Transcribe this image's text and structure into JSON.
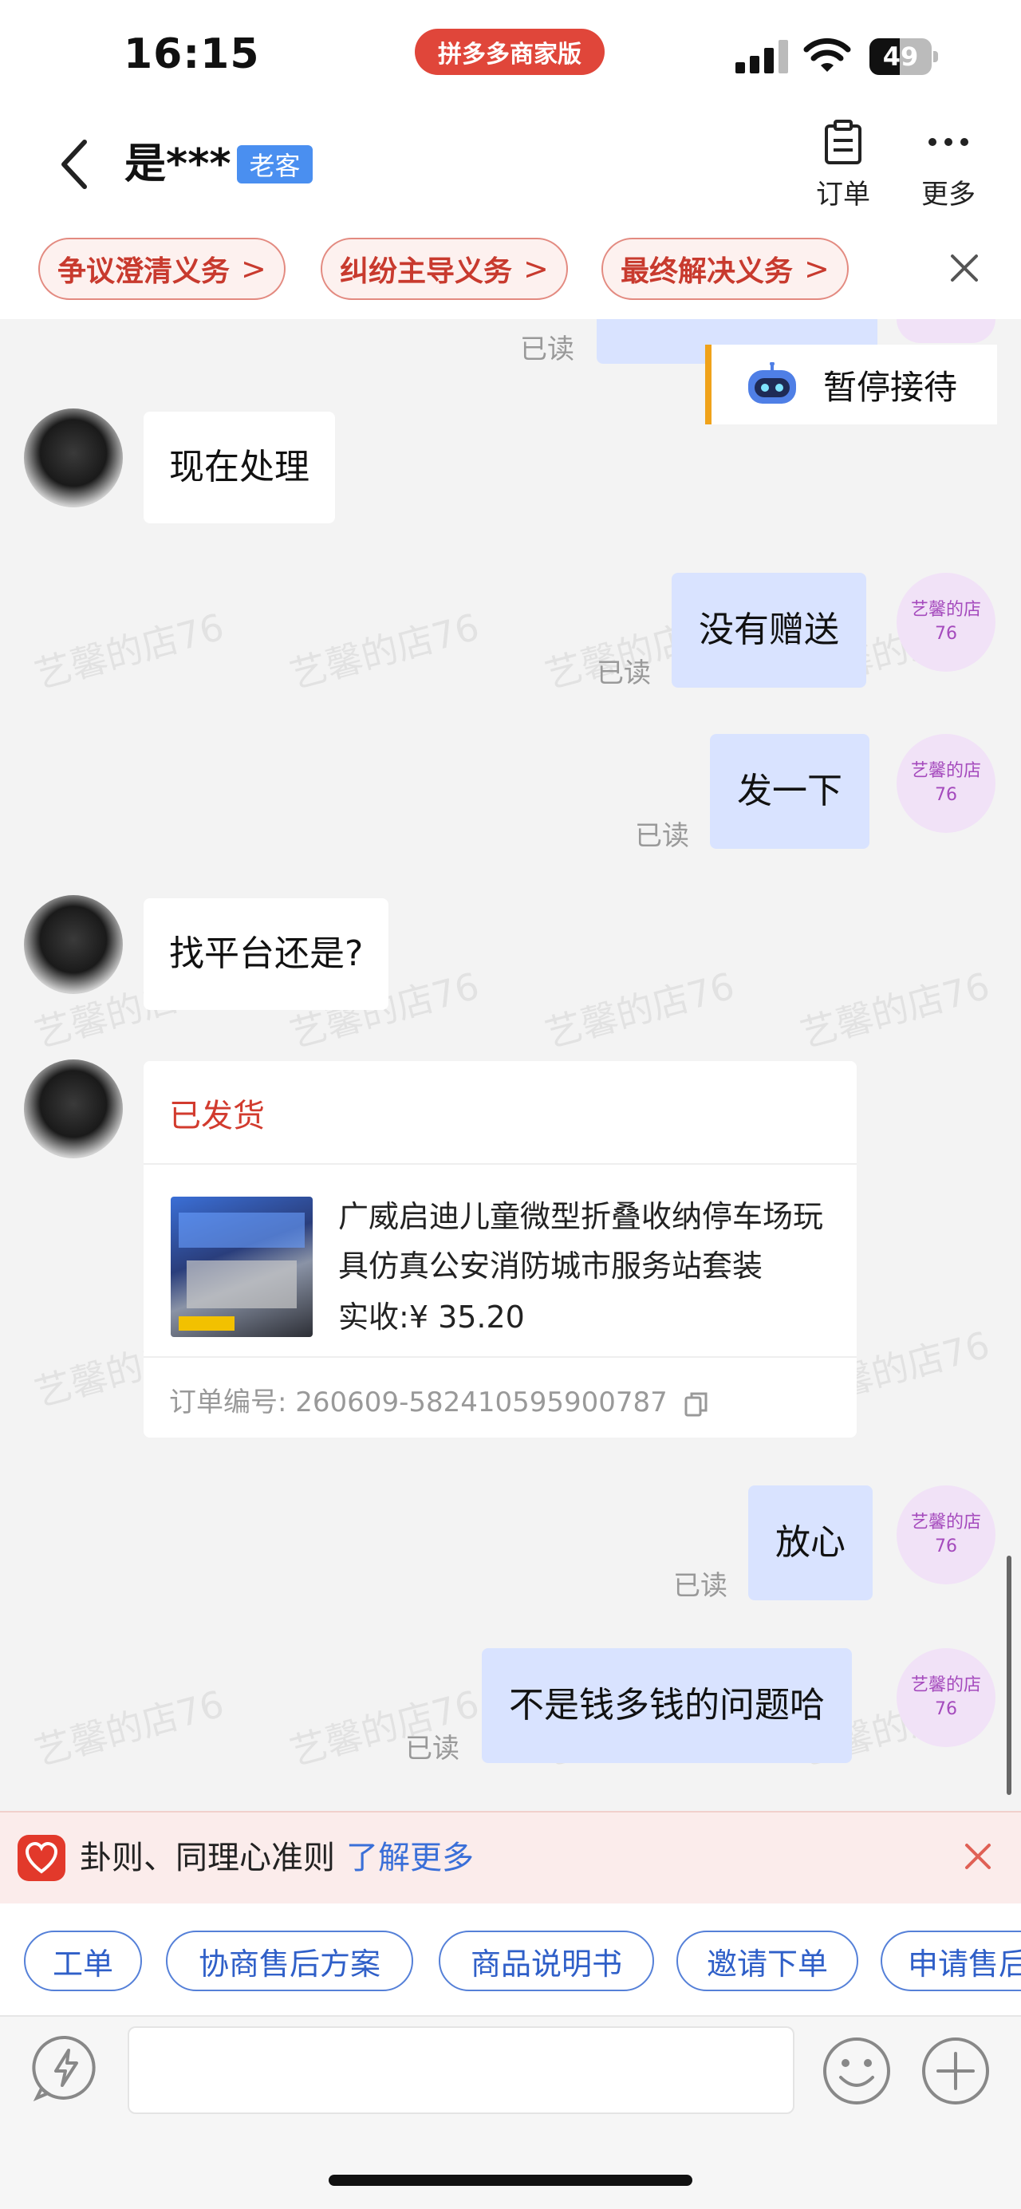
{
  "status_bar": {
    "time": "16:15",
    "app_pill": "拼多多商家版",
    "battery": "49"
  },
  "header": {
    "title": "是***",
    "tag": "老客",
    "order_label": "订单",
    "more_label": "更多"
  },
  "obligations": [
    "争议澄清义务",
    "纠纷主导义务",
    "最终解决义务"
  ],
  "pause_label": "暂停接待",
  "watermark": "艺馨的店76",
  "shop_avatar": {
    "line1": "艺馨的店",
    "line2": "76"
  },
  "read_label": "已读",
  "messages": {
    "m1": "现在处理",
    "m2": "没有赠送",
    "m3": "发一下",
    "m4": "找平台还是?",
    "m5": "放心",
    "m6": "不是钱多钱的问题哈"
  },
  "order_card": {
    "status": "已发货",
    "product_name": "广威启迪儿童微型折叠收纳停车场玩具仿真公安消防城市服务站套装",
    "price_label": "实收:",
    "price": "¥ 35.20",
    "order_no_label": "订单编号:",
    "order_no": "260609-582410595900787"
  },
  "notice": {
    "text": "卦则、同理心准则",
    "link": "了解更多"
  },
  "quick_actions": [
    "工单",
    "协商售后方案",
    "商品说明书",
    "邀请下单",
    "申请售后"
  ],
  "colors": {
    "accent_red": "#e0463a",
    "bubble_right": "#d9e3ff",
    "link_blue": "#3a6fd8"
  }
}
